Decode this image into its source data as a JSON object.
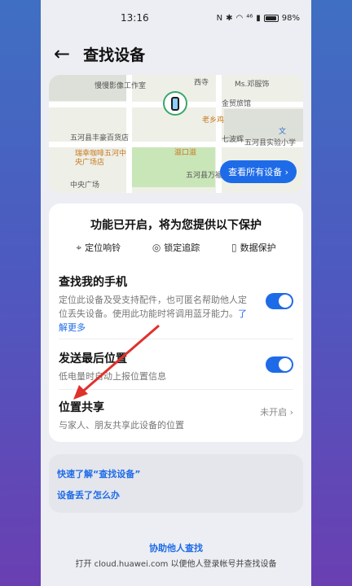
{
  "status_bar": {
    "time": "13:16",
    "battery": "98%",
    "network": "⁴⁶"
  },
  "header": {
    "title": "查找设备"
  },
  "map": {
    "pois": [
      "慢慢影像工作室",
      "西寺",
      "Ms.邓服饰",
      "金贸旅馆",
      "老乡鸡",
      "七波辉",
      "五河县丰豪百货店",
      "瑞幸咖啡五河中央广场店",
      "滋口滋",
      "中央广场",
      "五河县万福",
      "五河县实验小学",
      "文"
    ],
    "view_all_button": "查看所有设备"
  },
  "protection": {
    "title": "功能已开启，将为您提供以下保护",
    "items": [
      {
        "label": "定位响铃",
        "icon": "location-icon"
      },
      {
        "label": "锁定追踪",
        "icon": "lock-track-icon"
      },
      {
        "label": "数据保护",
        "icon": "phone-shield-icon"
      }
    ]
  },
  "settings": {
    "find_phone": {
      "title": "查找我的手机",
      "desc": "定位此设备及受支持配件，也可匿名帮助他人定位丢失设备。使用此功能时将调用蓝牙能力。",
      "more": "了解更多",
      "enabled": true
    },
    "last_location": {
      "title": "发送最后位置",
      "desc": "低电量时自动上报位置信息",
      "enabled": true
    },
    "share_location": {
      "title": "位置共享",
      "desc": "与家人、朋友共享此设备的位置",
      "status": "未开启"
    }
  },
  "help": {
    "link1": "快速了解“查找设备”",
    "link2": "设备丢了怎么办"
  },
  "footer": {
    "link": "协助他人查找",
    "note": "打开 cloud.huawei.com 以便他人登录帐号并查找设备"
  },
  "colors": {
    "accent": "#1e6be8",
    "annotation_arrow": "#e0322c"
  }
}
